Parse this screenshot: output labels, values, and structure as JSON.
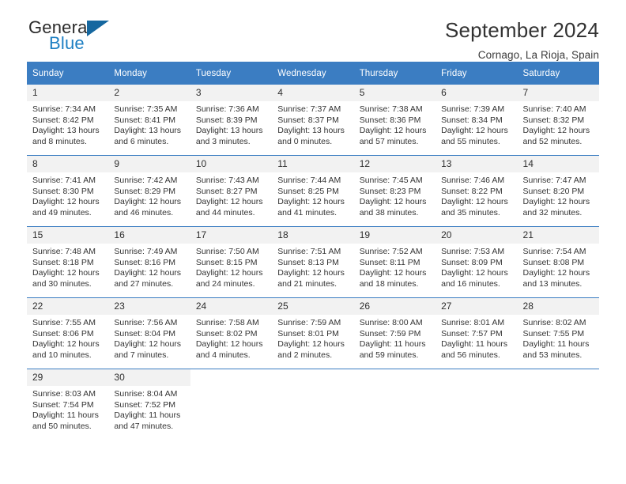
{
  "brand": {
    "name_part1": "General",
    "name_part2": "Blue",
    "triangle_icon": "triangle-icon",
    "accent_color": "#1d7fc3",
    "header_color": "#3b7dc2"
  },
  "header": {
    "title": "September 2024",
    "subtitle": "Cornago, La Rioja, Spain"
  },
  "calendar": {
    "weekday_headers": [
      "Sunday",
      "Monday",
      "Tuesday",
      "Wednesday",
      "Thursday",
      "Friday",
      "Saturday"
    ],
    "weeks": [
      [
        {
          "day": "1",
          "sunrise": "Sunrise: 7:34 AM",
          "sunset": "Sunset: 8:42 PM",
          "daylight_line1": "Daylight: 13 hours",
          "daylight_line2": "and 8 minutes."
        },
        {
          "day": "2",
          "sunrise": "Sunrise: 7:35 AM",
          "sunset": "Sunset: 8:41 PM",
          "daylight_line1": "Daylight: 13 hours",
          "daylight_line2": "and 6 minutes."
        },
        {
          "day": "3",
          "sunrise": "Sunrise: 7:36 AM",
          "sunset": "Sunset: 8:39 PM",
          "daylight_line1": "Daylight: 13 hours",
          "daylight_line2": "and 3 minutes."
        },
        {
          "day": "4",
          "sunrise": "Sunrise: 7:37 AM",
          "sunset": "Sunset: 8:37 PM",
          "daylight_line1": "Daylight: 13 hours",
          "daylight_line2": "and 0 minutes."
        },
        {
          "day": "5",
          "sunrise": "Sunrise: 7:38 AM",
          "sunset": "Sunset: 8:36 PM",
          "daylight_line1": "Daylight: 12 hours",
          "daylight_line2": "and 57 minutes."
        },
        {
          "day": "6",
          "sunrise": "Sunrise: 7:39 AM",
          "sunset": "Sunset: 8:34 PM",
          "daylight_line1": "Daylight: 12 hours",
          "daylight_line2": "and 55 minutes."
        },
        {
          "day": "7",
          "sunrise": "Sunrise: 7:40 AM",
          "sunset": "Sunset: 8:32 PM",
          "daylight_line1": "Daylight: 12 hours",
          "daylight_line2": "and 52 minutes."
        }
      ],
      [
        {
          "day": "8",
          "sunrise": "Sunrise: 7:41 AM",
          "sunset": "Sunset: 8:30 PM",
          "daylight_line1": "Daylight: 12 hours",
          "daylight_line2": "and 49 minutes."
        },
        {
          "day": "9",
          "sunrise": "Sunrise: 7:42 AM",
          "sunset": "Sunset: 8:29 PM",
          "daylight_line1": "Daylight: 12 hours",
          "daylight_line2": "and 46 minutes."
        },
        {
          "day": "10",
          "sunrise": "Sunrise: 7:43 AM",
          "sunset": "Sunset: 8:27 PM",
          "daylight_line1": "Daylight: 12 hours",
          "daylight_line2": "and 44 minutes."
        },
        {
          "day": "11",
          "sunrise": "Sunrise: 7:44 AM",
          "sunset": "Sunset: 8:25 PM",
          "daylight_line1": "Daylight: 12 hours",
          "daylight_line2": "and 41 minutes."
        },
        {
          "day": "12",
          "sunrise": "Sunrise: 7:45 AM",
          "sunset": "Sunset: 8:23 PM",
          "daylight_line1": "Daylight: 12 hours",
          "daylight_line2": "and 38 minutes."
        },
        {
          "day": "13",
          "sunrise": "Sunrise: 7:46 AM",
          "sunset": "Sunset: 8:22 PM",
          "daylight_line1": "Daylight: 12 hours",
          "daylight_line2": "and 35 minutes."
        },
        {
          "day": "14",
          "sunrise": "Sunrise: 7:47 AM",
          "sunset": "Sunset: 8:20 PM",
          "daylight_line1": "Daylight: 12 hours",
          "daylight_line2": "and 32 minutes."
        }
      ],
      [
        {
          "day": "15",
          "sunrise": "Sunrise: 7:48 AM",
          "sunset": "Sunset: 8:18 PM",
          "daylight_line1": "Daylight: 12 hours",
          "daylight_line2": "and 30 minutes."
        },
        {
          "day": "16",
          "sunrise": "Sunrise: 7:49 AM",
          "sunset": "Sunset: 8:16 PM",
          "daylight_line1": "Daylight: 12 hours",
          "daylight_line2": "and 27 minutes."
        },
        {
          "day": "17",
          "sunrise": "Sunrise: 7:50 AM",
          "sunset": "Sunset: 8:15 PM",
          "daylight_line1": "Daylight: 12 hours",
          "daylight_line2": "and 24 minutes."
        },
        {
          "day": "18",
          "sunrise": "Sunrise: 7:51 AM",
          "sunset": "Sunset: 8:13 PM",
          "daylight_line1": "Daylight: 12 hours",
          "daylight_line2": "and 21 minutes."
        },
        {
          "day": "19",
          "sunrise": "Sunrise: 7:52 AM",
          "sunset": "Sunset: 8:11 PM",
          "daylight_line1": "Daylight: 12 hours",
          "daylight_line2": "and 18 minutes."
        },
        {
          "day": "20",
          "sunrise": "Sunrise: 7:53 AM",
          "sunset": "Sunset: 8:09 PM",
          "daylight_line1": "Daylight: 12 hours",
          "daylight_line2": "and 16 minutes."
        },
        {
          "day": "21",
          "sunrise": "Sunrise: 7:54 AM",
          "sunset": "Sunset: 8:08 PM",
          "daylight_line1": "Daylight: 12 hours",
          "daylight_line2": "and 13 minutes."
        }
      ],
      [
        {
          "day": "22",
          "sunrise": "Sunrise: 7:55 AM",
          "sunset": "Sunset: 8:06 PM",
          "daylight_line1": "Daylight: 12 hours",
          "daylight_line2": "and 10 minutes."
        },
        {
          "day": "23",
          "sunrise": "Sunrise: 7:56 AM",
          "sunset": "Sunset: 8:04 PM",
          "daylight_line1": "Daylight: 12 hours",
          "daylight_line2": "and 7 minutes."
        },
        {
          "day": "24",
          "sunrise": "Sunrise: 7:58 AM",
          "sunset": "Sunset: 8:02 PM",
          "daylight_line1": "Daylight: 12 hours",
          "daylight_line2": "and 4 minutes."
        },
        {
          "day": "25",
          "sunrise": "Sunrise: 7:59 AM",
          "sunset": "Sunset: 8:01 PM",
          "daylight_line1": "Daylight: 12 hours",
          "daylight_line2": "and 2 minutes."
        },
        {
          "day": "26",
          "sunrise": "Sunrise: 8:00 AM",
          "sunset": "Sunset: 7:59 PM",
          "daylight_line1": "Daylight: 11 hours",
          "daylight_line2": "and 59 minutes."
        },
        {
          "day": "27",
          "sunrise": "Sunrise: 8:01 AM",
          "sunset": "Sunset: 7:57 PM",
          "daylight_line1": "Daylight: 11 hours",
          "daylight_line2": "and 56 minutes."
        },
        {
          "day": "28",
          "sunrise": "Sunrise: 8:02 AM",
          "sunset": "Sunset: 7:55 PM",
          "daylight_line1": "Daylight: 11 hours",
          "daylight_line2": "and 53 minutes."
        }
      ],
      [
        {
          "day": "29",
          "sunrise": "Sunrise: 8:03 AM",
          "sunset": "Sunset: 7:54 PM",
          "daylight_line1": "Daylight: 11 hours",
          "daylight_line2": "and 50 minutes."
        },
        {
          "day": "30",
          "sunrise": "Sunrise: 8:04 AM",
          "sunset": "Sunset: 7:52 PM",
          "daylight_line1": "Daylight: 11 hours",
          "daylight_line2": "and 47 minutes."
        },
        {
          "day": "",
          "sunrise": "",
          "sunset": "",
          "daylight_line1": "",
          "daylight_line2": ""
        },
        {
          "day": "",
          "sunrise": "",
          "sunset": "",
          "daylight_line1": "",
          "daylight_line2": ""
        },
        {
          "day": "",
          "sunrise": "",
          "sunset": "",
          "daylight_line1": "",
          "daylight_line2": ""
        },
        {
          "day": "",
          "sunrise": "",
          "sunset": "",
          "daylight_line1": "",
          "daylight_line2": ""
        },
        {
          "day": "",
          "sunrise": "",
          "sunset": "",
          "daylight_line1": "",
          "daylight_line2": ""
        }
      ]
    ]
  }
}
